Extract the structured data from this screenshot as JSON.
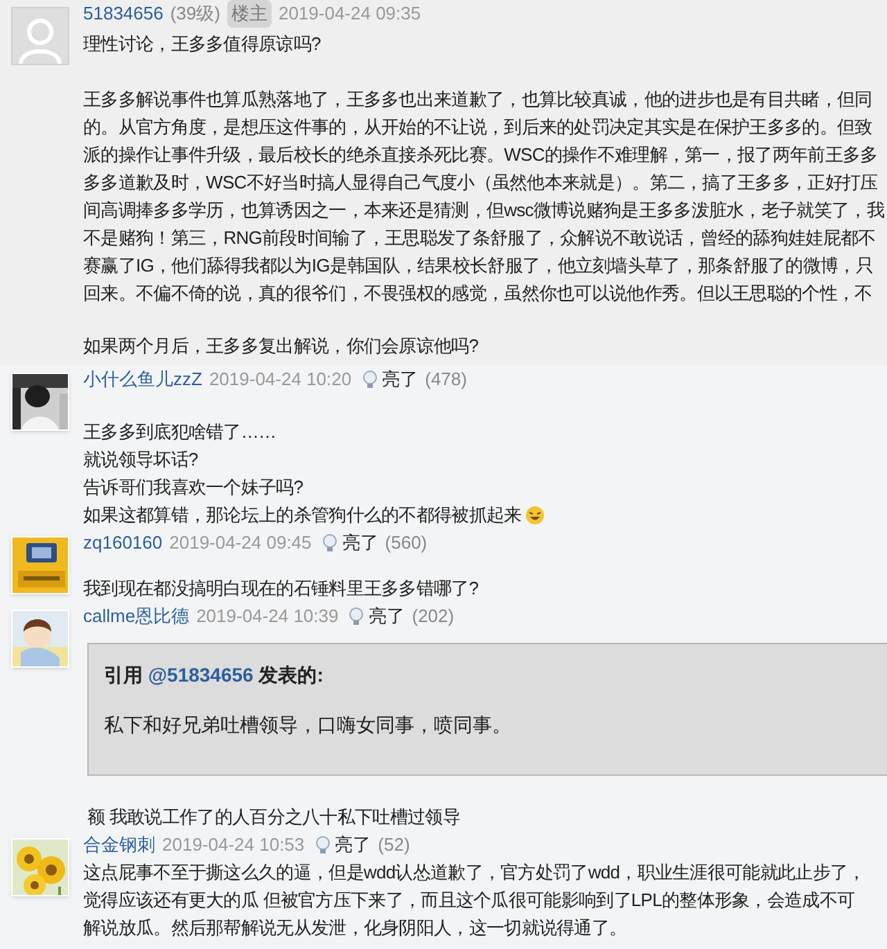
{
  "posts": [
    {
      "kind": "op",
      "user": "51834656",
      "rank": "(39级)",
      "badge": "楼主",
      "time": "2019-04-24 09:35",
      "avatar": {
        "kind": "default"
      },
      "blocks": [
        {
          "kind": "title",
          "lines": [
            "理性讨论，王多多值得原谅吗?"
          ]
        },
        {
          "kind": "text",
          "lines": [
            "王多多解说事件也算瓜熟落地了，王多多也出来道歉了，也算比较真诚，他的进步也是有目共睹，但同",
            "的。从官方角度，是想压这件事的，从开始的不让说，到后来的处罚决定其实是在保护王多多的。但致",
            "派的操作让事件升级，最后校长的绝杀直接杀死比赛。WSC的操作不难理解，第一，报了两年前王多多",
            "多多道歉及时，WSC不好当时搞人显得自己气度小（虽然他本来就是）。第二，搞了王多多，正好打压",
            "间高调捧多多学历，也算诱因之一，本来还是猜测，但wsc微博说赌狗是王多多泼脏水，老子就笑了，我",
            "不是赌狗！第三，RNG前段时间输了，王思聪发了条舒服了，众解说不敢说话，曾经的舔狗娃娃屁都不",
            "赛赢了IG，他们舔得我都以为IG是韩国队，结果校长舒服了，他立刻墙头草了，那条舒服了的微博，只",
            "回来。不偏不倚的说，真的很爷们，不畏强权的感觉，虽然你也可以说他作秀。但以王思聪的个性，不"
          ]
        },
        {
          "kind": "text",
          "lines": [
            "如果两个月后，王多多复出解说，你们会原谅他吗?"
          ]
        }
      ]
    },
    {
      "kind": "reply",
      "user": "小什么鱼儿zzZ",
      "time": "2019-04-24 10:20",
      "like_label": "亮了",
      "likes": "(478)",
      "avatar": {
        "kind": "picture"
      },
      "trailing_emoji": true,
      "blocks": [
        {
          "kind": "text",
          "lines": [
            "王多多到底犯啥错了……",
            "就说领导坏话?",
            "告诉哥们我喜欢一个妹子吗?",
            "如果这都算错，那论坛上的杀管狗什么的不都得被抓起来"
          ]
        }
      ]
    },
    {
      "kind": "reply",
      "user": "zq160160",
      "time": "2019-04-24 09:45",
      "like_label": "亮了",
      "likes": "(560)",
      "avatar": {
        "kind": "picture"
      },
      "blocks": [
        {
          "kind": "text",
          "lines": [
            "我到现在都没搞明白现在的石锤料里王多多错哪了?"
          ]
        }
      ]
    },
    {
      "kind": "reply",
      "user": "callme恩比德",
      "time": "2019-04-24 10:39",
      "like_label": "亮了",
      "likes": "(202)",
      "avatar": {
        "kind": "picture"
      },
      "blocks": [
        {
          "kind": "quote",
          "prefix": "引用",
          "user": "@51834656",
          "suffix": "发表的:",
          "text": "私下和好兄弟吐槽领导，口嗨女同事，喷同事。"
        },
        {
          "kind": "text",
          "lines": [
            "额 我敢说工作了的人百分之八十私下吐槽过领导"
          ]
        }
      ]
    },
    {
      "kind": "reply",
      "user": "合金钢刺",
      "time": "2019-04-24 10:53",
      "like_label": "亮了",
      "likes": "(52)",
      "avatar": {
        "kind": "picture"
      },
      "blocks": [
        {
          "kind": "text",
          "lines": [
            "这点屁事不至于撕这么久的逼，但是wdd认怂道歉了，官方处罚了wdd，职业生涯很可能就此止步了，",
            "觉得应该还有更大的瓜 但被官方压下来了，而且这个瓜很可能影响到了LPL的整体形象，会造成不可",
            "解说放瓜。然后那帮解说无从发泄，化身阴阳人，这一切就说得通了。"
          ]
        }
      ]
    }
  ]
}
